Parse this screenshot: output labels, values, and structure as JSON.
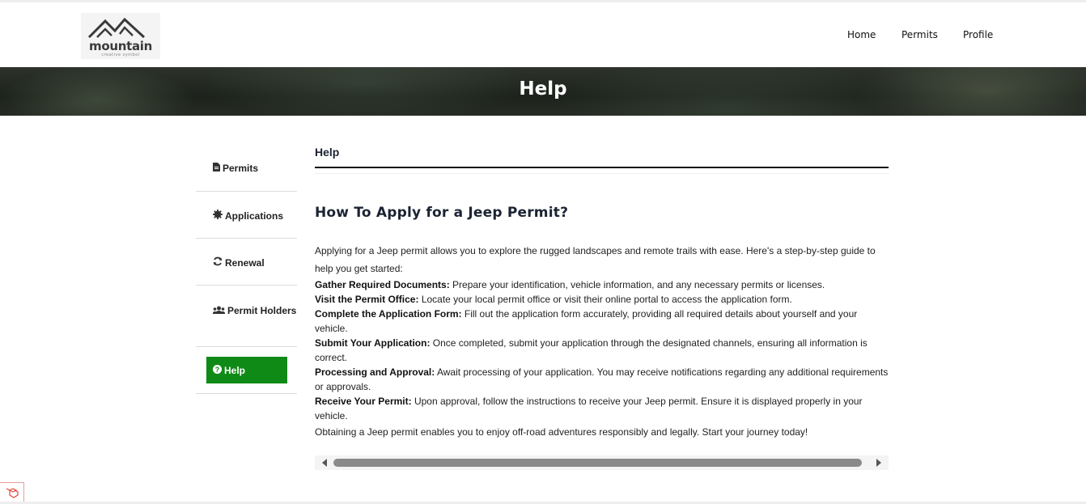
{
  "header": {
    "logo_word": "mountain",
    "logo_tagline": "creative symbol",
    "nav": [
      "Home",
      "Permits",
      "Profile"
    ]
  },
  "banner": {
    "title": "Help"
  },
  "sidebar": {
    "items": [
      {
        "icon": "file-icon",
        "label": "Permits"
      },
      {
        "icon": "gear-icon",
        "label": "Applications"
      },
      {
        "icon": "refresh-icon",
        "label": "Renewal"
      },
      {
        "icon": "users-icon",
        "label": "Permit Holders"
      },
      {
        "icon": "question-circle-icon",
        "label": "Help",
        "active": true
      }
    ]
  },
  "main": {
    "heading": "Help",
    "article_title": "How To Apply for a Jeep Permit?",
    "intro": "Applying for a Jeep permit allows you to explore the rugged landscapes and remote trails with ease. Here's a step-by-step guide to help you get started:",
    "steps": [
      {
        "title": "Gather Required Documents:",
        "text": " Prepare your identification, vehicle information, and any necessary permits or licenses."
      },
      {
        "title": "Visit the Permit Office:",
        "text": " Locate your local permit office or visit their online portal to access the application form."
      },
      {
        "title": "Complete the Application Form:",
        "text": " Fill out the application form accurately, providing all required details about yourself and your vehicle."
      },
      {
        "title": "Submit Your Application:",
        "text": " Once completed, submit your application through the designated channels, ensuring all information is correct."
      },
      {
        "title": "Processing and Approval:",
        "text": " Await processing of your application. You may receive notifications regarding any additional requirements or approvals."
      },
      {
        "title": "Receive Your Permit:",
        "text": " Upon approval, follow the instructions to receive your Jeep permit. Ensure it is displayed properly in your vehicle."
      }
    ],
    "outro": "Obtaining a Jeep permit enables you to enjoy off-road adventures responsibly and legally. Start your journey today!"
  },
  "colors": {
    "accent_green": "#108a16",
    "heading": "#1b2333",
    "scroll_thumb": "#8a8a8a"
  }
}
